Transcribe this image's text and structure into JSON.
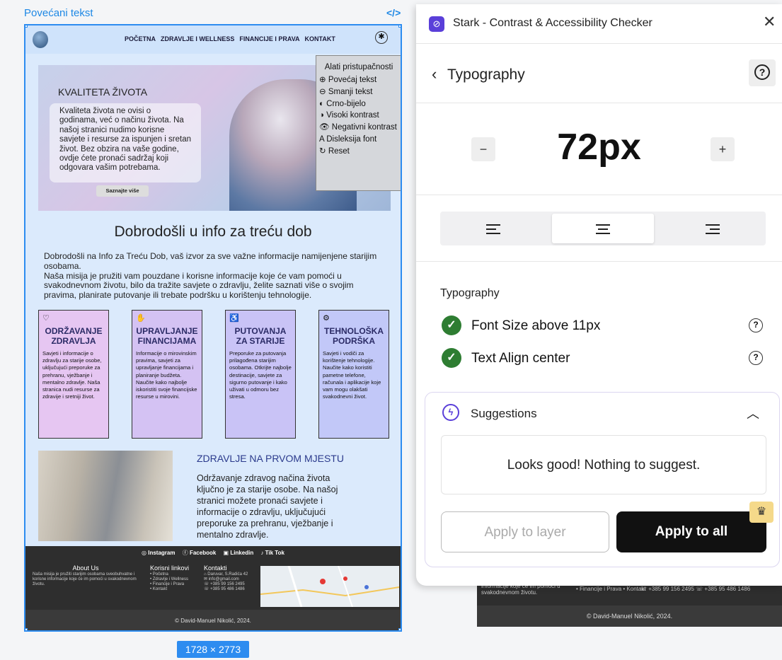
{
  "canvas": {
    "frame_label": "Povećani tekst",
    "code_icon": "</>",
    "size_badge": "1728 × 2773"
  },
  "site": {
    "nav": [
      "POČETNA",
      "ZDRAVLJE I WELLNESS",
      "FINANCIJE I PRAVA",
      "KONTAKT"
    ],
    "hero": {
      "title": "KVALITETA ŽIVOTA",
      "text": "Kvaliteta života ne ovisi o godinama, već o načinu života. Na našoj stranici nudimo korisne savjete i resurse za ispunjen i sretan život. Bez obzira na vaše godine, ovdje ćete pronaći sadržaj koji odgovara vašim potrebama.",
      "button": "Saznajte više"
    },
    "tools": {
      "title": "Alati pristupačnosti",
      "items": [
        "⊕ Povećaj tekst",
        "⊖ Smanji tekst",
        "◐ Crno-bijelo",
        "◑ Visoki kontrast",
        "👁 Negativni kontrast",
        "A Disleksija font",
        "↻ Reset"
      ]
    },
    "welcome": {
      "title": "Dobrodošli u info za treću dob",
      "text1": "Dobrodošli na Info za Treću Dob, vaš izvor za sve važne informacije namijenjene starijim osobama.",
      "text2": "Naša misija je pružiti vam pouzdane i korisne informacije koje će vam pomoći u svakodnevnom životu, bilo da tražite savjete o zdravlju, želite saznati više o svojim pravima, planirate putovanje ili trebate podršku u korištenju tehnologije."
    },
    "cards": [
      {
        "icon": "♡",
        "title": "ODRŽAVANJE ZDRAVLJA",
        "text": "Savjeti i informacije o zdravlju za starije osobe, uključujući preporuke za prehranu, vježbanje i mentalno zdravlje. Naša stranica nudi resurse za zdravije i sretniji život.",
        "color": "#e6c6f2"
      },
      {
        "icon": "✋",
        "title": "UPRAVLJANJE FINANCIJAMA",
        "text": "Informacije o mirovinskim pravima, savjeti za upravljanje financijama i planiranje budžeta. Naučite kako najbolje iskoristiti svoje financijske resurse u mirovini.",
        "color": "#d4c2f3"
      },
      {
        "icon": "♿",
        "title": "PUTOVANJA ZA STARIJE",
        "text": "Preporuke za putovanja prilagođena starijim osobama. Otkrijte najbolje destinacije, savjete za sigurno putovanje i kako uživati u odmoru bez stresa.",
        "color": "#c9c3f6"
      },
      {
        "icon": "⚙",
        "title": "TEHNOLOŠKA PODRŠKA",
        "text": "Savjeti i vodiči za korištenje tehnologije. Naučite kako koristiti pametne telefone, računala i aplikacije koje vam mogu olakšati svakodnevni život.",
        "color": "#c2c8f8"
      }
    ],
    "health": {
      "title": "ZDRAVLJE NA PRVOM MJESTU",
      "text": "Održavanje zdravog načina života ključno je za starije osobe. Na našoj stranici možete pronaći savjete i informacije o zdravlju, uključujući preporuke za prehranu, vježbanje i mentalno zdravlje."
    },
    "footer": {
      "social": [
        "Instagram",
        "Facebook",
        "Linkedin",
        "Tik Tok"
      ],
      "about_title": "About Us",
      "about_text": "Naša misija je pružiti starijim osobama sveobuhvatne i korisne informacije koje će im pomoći u svakodnevnom životu.",
      "links_title": "Korisni linkovi",
      "links": [
        "• Početna",
        "• Zdravlje i Wellness",
        "• Financije i Prava",
        "• Kontakt"
      ],
      "contact_title": "Kontakti",
      "contact": [
        "⌂ Daruvar, S.Radića 42",
        "✉ info@gmail.com",
        "☏ +385 99 156 2495",
        "☏ +385 95 486 1486"
      ],
      "copyright": "© David-Manuel Nikolić, 2024."
    },
    "bg_footer": {
      "col1": "informacije koje će im pomoći u svakodnevnom životu.",
      "col2": "• Financije i Prava   • Kontakt",
      "col3": "☏ +385 99 156 2495   ☏ +385 95 486 1486",
      "copyright": "© David-Manuel Nikolić, 2024."
    }
  },
  "panel": {
    "title": "Stark - Contrast & Accessibility Checker",
    "section": "Typography",
    "size_value": "72px",
    "minus": "−",
    "plus": "+",
    "align_icons": [
      "align-left-icon",
      "align-center-icon",
      "align-right-icon"
    ],
    "align_selected": "center",
    "checks_title": "Typography",
    "checks": [
      {
        "label": "Font Size above 11px",
        "status": "pass"
      },
      {
        "label": "Text Align center",
        "status": "pass"
      }
    ],
    "suggestions_title": "Suggestions",
    "suggestions_message": "Looks good! Nothing to suggest.",
    "apply_layer": "Apply to layer",
    "apply_all": "Apply to all",
    "colors": {
      "accent": "#5a3fd9",
      "pass": "#2e7d32",
      "primary_button": "#111111"
    }
  }
}
